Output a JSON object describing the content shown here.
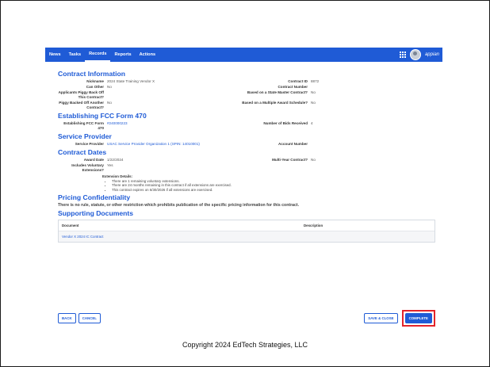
{
  "nav": {
    "items": [
      "News",
      "Tasks",
      "Records",
      "Reports",
      "Actions"
    ],
    "active": "Records",
    "logo": "appian"
  },
  "contract_information": {
    "title": "Contract Information",
    "nickname_label": "Nickname",
    "nickname_value": "2024 State Training Vendor X",
    "contract_id_label": "Contract ID",
    "contract_id_value": "8872",
    "can_other_label": "Can Other",
    "can_other_value": "No",
    "contract_number_label": "Contract Number",
    "contract_number_value": "",
    "applicants_label": "Applicants Piggy Back Off This Contract?",
    "based_state_label": "Based on a State Master Contract?",
    "based_state_value": "No",
    "piggy_label": "Piggy Backed Off Another Contract?",
    "piggy_value": "No",
    "based_multiple_label": "Based on a Multiple Award Schedule?",
    "based_multiple_value": "No"
  },
  "fcc": {
    "title": "Establishing FCC Form 470",
    "form_label": "Establishing FCC Form 470",
    "form_value": "#240000223",
    "bids_label": "Number of Bids Received",
    "bids_value": "4"
  },
  "service_provider": {
    "title": "Service Provider",
    "sp_label": "Service Provider",
    "sp_value": "USAC Service Provider Organization 1 (SPIN: 14010001)",
    "account_label": "Account Number",
    "account_value": ""
  },
  "contract_dates": {
    "title": "Contract Dates",
    "award_label": "Award Date",
    "award_value": "1/22/2024",
    "multi_label": "Multi-Year Contract?",
    "multi_value": "No",
    "voluntary_label": "Includes Voluntary Extensions?",
    "voluntary_value": "Yes",
    "ext_title": "Extension Details:",
    "ext_items": [
      "There are 1 remaining voluntary extensions.",
      "There are 24 months remaining in this contract if all extensions are exercised.",
      "This contract expires on 6/30/2026 if all extensions are exercised."
    ]
  },
  "pricing": {
    "title": "Pricing Confidentiality",
    "note": "There is no rule, statute, or other restriction which prohibits publication of the specific pricing information for this contract."
  },
  "documents": {
    "title": "Supporting Documents",
    "col_document": "Document",
    "col_description": "Description",
    "rows": [
      {
        "document": "Vendor X 2024 IC Contract",
        "description": ""
      }
    ]
  },
  "buttons": {
    "back": "BACK",
    "cancel": "CANCEL",
    "save_close": "SAVE & CLOSE",
    "complete": "COMPLETE"
  },
  "colors": {
    "accent": "#1f5bd6",
    "highlight": "#e3242b"
  },
  "copyright": "Copyright 2024 EdTech Strategies, LLC"
}
